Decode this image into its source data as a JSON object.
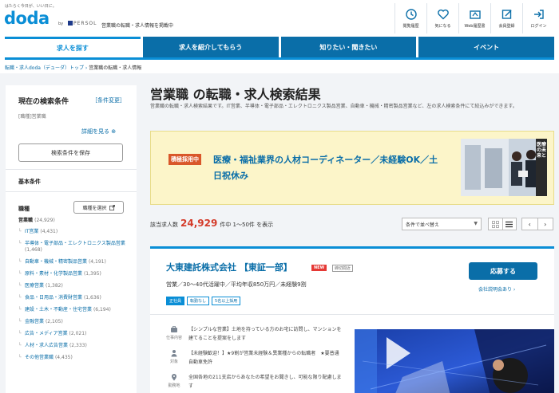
{
  "header": {
    "tagline": "はたらく今日が、いい日に。",
    "logo": "doda",
    "by": "by",
    "persol": "PERSOL",
    "site_desc": "営業職の転職・求人情報を掲載中",
    "icons": [
      {
        "name": "history-icon",
        "label": "閲覧履歴"
      },
      {
        "name": "heart-icon",
        "label": "気になる"
      },
      {
        "name": "resume-icon",
        "label": "Web履歴書"
      },
      {
        "name": "register-icon",
        "label": "会員登録"
      },
      {
        "name": "login-icon",
        "label": "ログイン"
      }
    ]
  },
  "nav": {
    "tabs": [
      "求人を探す",
      "求人を紹介してもらう",
      "知りたい・聞きたい",
      "イベント"
    ]
  },
  "breadcrumb": {
    "items": [
      "転職・求人doda（デューダ）トップ",
      "営業職の転職・求人情報"
    ]
  },
  "sidebar": {
    "title": "現在の検索条件",
    "edit": "［条件変更］",
    "condition": "[職種]営業職",
    "detail": "詳細を見る ⊕",
    "save": "検索条件を保存",
    "basic": "基本条件",
    "job_label": "職種",
    "pick": "職種を選択",
    "items": [
      {
        "label": "営業職",
        "count": "(24,929)",
        "level": 0
      },
      {
        "label": "IT営業",
        "count": "(4,431)",
        "level": 1
      },
      {
        "label": "半導体・電子部品・エレクトロニクス製品営業",
        "count": "(1,468)",
        "level": 1
      },
      {
        "label": "自動車・機械・精密製品営業",
        "count": "(4,191)",
        "level": 1
      },
      {
        "label": "原料・素材・化学製品営業",
        "count": "(1,395)",
        "level": 1
      },
      {
        "label": "医療営業",
        "count": "(1,382)",
        "level": 1
      },
      {
        "label": "食品・日用品・消費財営業",
        "count": "(1,636)",
        "level": 1
      },
      {
        "label": "建設・土木・不動産・住宅営業",
        "count": "(6,194)",
        "level": 1
      },
      {
        "label": "金融営業",
        "count": "(2,105)",
        "level": 1
      },
      {
        "label": "広告・メディア営業",
        "count": "(2,021)",
        "level": 1
      },
      {
        "label": "人材・求人広告営業",
        "count": "(2,333)",
        "level": 1
      },
      {
        "label": "その他営業職",
        "count": "(4,435)",
        "level": 1
      }
    ]
  },
  "main": {
    "title": "営業職 の転職・求人検索結果",
    "desc": "営業職の転職・求人検索結果です。IT営業、半導体・電子部品・エレクトロニクス製品営業、自動車・機械・精密製品営業など、左の求人検索条件にて絞込みができます。",
    "ad": {
      "badge": "積極採用中",
      "text": "医療・福祉業界の人材コーディネーター／未経験OK／土日祝休み",
      "img_text": "医療の未来と"
    },
    "count_label": "該当求人数",
    "count": "24,929",
    "count_suffix": "件中 1〜50件 を表示",
    "sort": "条件で並べ替え",
    "pager_prev": "‹",
    "pager_next": "›"
  },
  "job": {
    "company": "大東建託株式会社 【東証一部】",
    "new": "NEW",
    "listed": "締切間近",
    "title": "営業／30〜40代活躍中／平均年収850万円／未経験9割",
    "tags": [
      "正社員",
      "転勤なし",
      "5名以上採用"
    ],
    "apply": "応募する",
    "session": "会社説明会あり ›",
    "rows": [
      {
        "icon": "briefcase-icon",
        "label": "仕事内容",
        "text": "【シンプルな営業】土地を持っている方のお宅に訪問し、マンションを建てることを提案をします"
      },
      {
        "icon": "person-icon",
        "label": "対象",
        "text": "【未経験歓迎！】★9割が営業未経験＆異業種からの転職者　★要普通自動車免許"
      },
      {
        "icon": "pin-icon",
        "label": "勤務地",
        "text": "全国各地の211支店からあなたの希望をお聞きし、可能な限り配慮します"
      }
    ]
  },
  "colors": {
    "brand": "#0a8ed6",
    "nav": "#0a6ea8",
    "count": "#d43b2a",
    "ad_bg": "#fcf5c9",
    "badge": "#d9572a"
  }
}
